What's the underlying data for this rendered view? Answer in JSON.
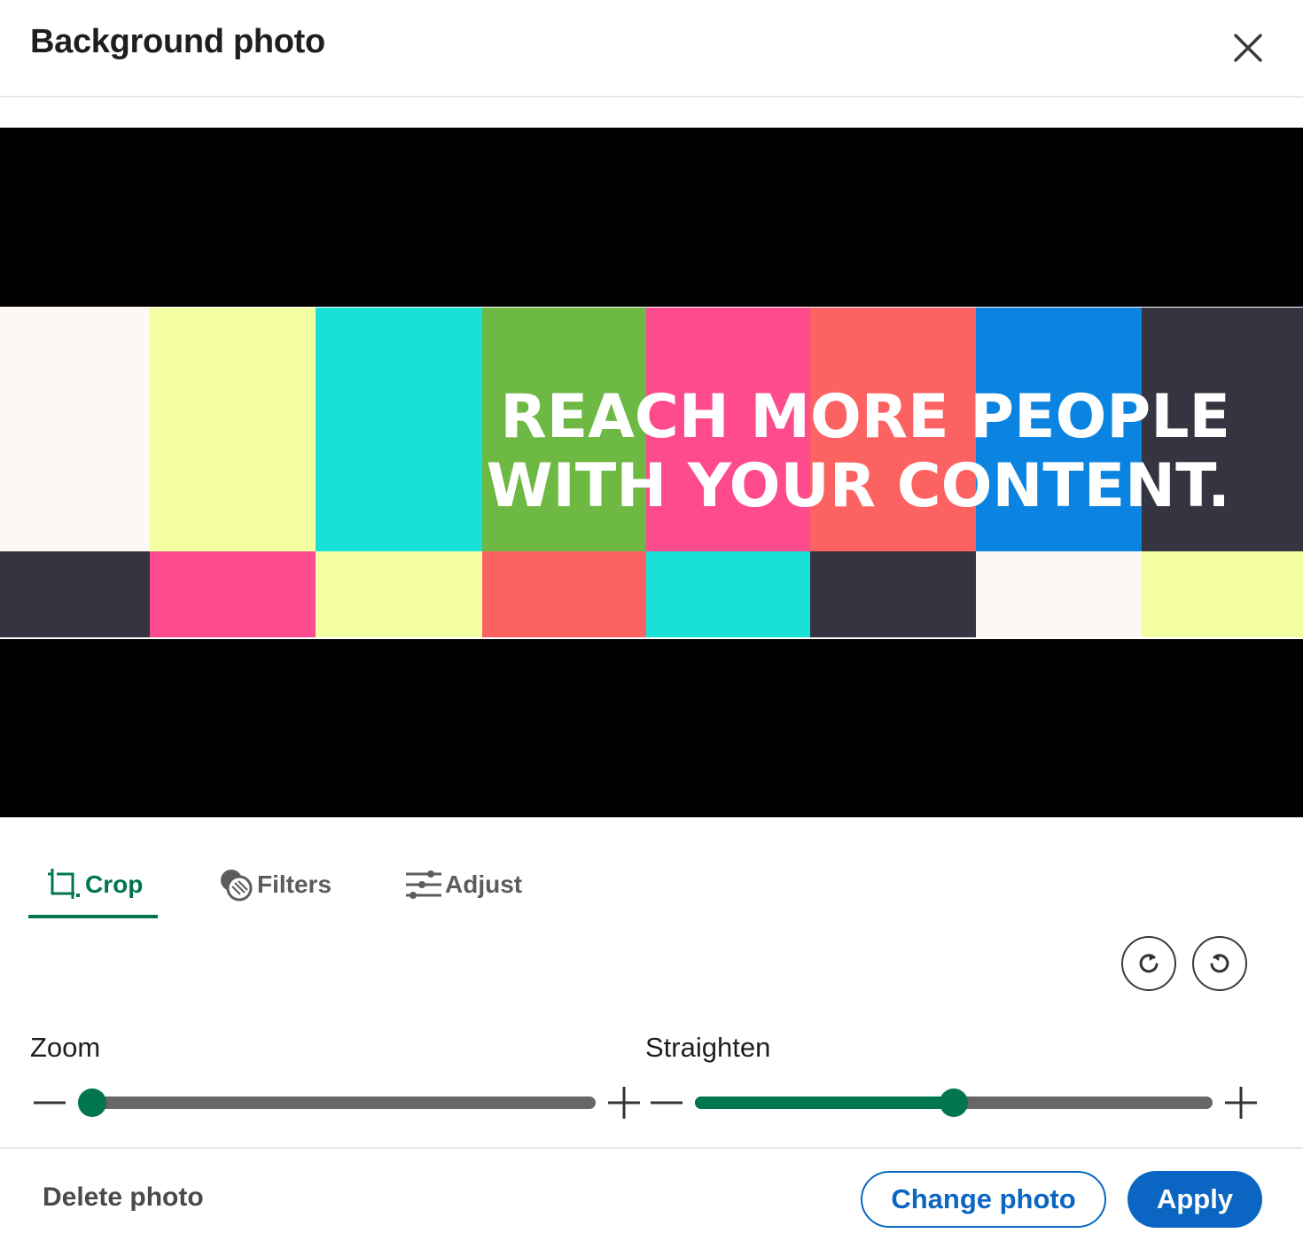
{
  "dialog": {
    "title": "Background photo",
    "close_icon": "close-icon"
  },
  "photo": {
    "headline_line1": "REACH MORE PEOPLE",
    "headline_line2": "WITH YOUR CONTENT.",
    "palette": {
      "cream": "#fdf8f3",
      "yellow": "#f4ffa1",
      "cyan": "#1ae1d8",
      "green": "#6db944",
      "pink": "#fd4b8d",
      "coral": "#fc6261",
      "blue": "#0a84e0",
      "dark": "#343541"
    },
    "top_row": [
      "cream",
      "yellow",
      "cyan",
      "green",
      "pink",
      "coral",
      "blue",
      "dark"
    ],
    "bottom_row": [
      "dark",
      "pink",
      "yellow",
      "coral",
      "cyan",
      "dark",
      "cream",
      "yellow"
    ]
  },
  "tabs": [
    {
      "label": "Crop",
      "icon": "crop-icon",
      "active": true
    },
    {
      "label": "Filters",
      "icon": "filters-icon",
      "active": false
    },
    {
      "label": "Adjust",
      "icon": "adjust-icon",
      "active": false
    }
  ],
  "rotate": {
    "clockwise_icon": "rotate-clockwise-icon",
    "counterclockwise_icon": "rotate-counterclockwise-icon"
  },
  "zoom": {
    "label": "Zoom",
    "value_fraction": 0.0
  },
  "straighten": {
    "label": "Straighten",
    "value_fraction": 0.5
  },
  "footer": {
    "delete_label": "Delete photo",
    "change_label": "Change photo",
    "apply_label": "Apply"
  },
  "colors": {
    "accent_green": "#01754f",
    "linkedin_blue": "#0a66c2",
    "track_gray": "#666666"
  }
}
